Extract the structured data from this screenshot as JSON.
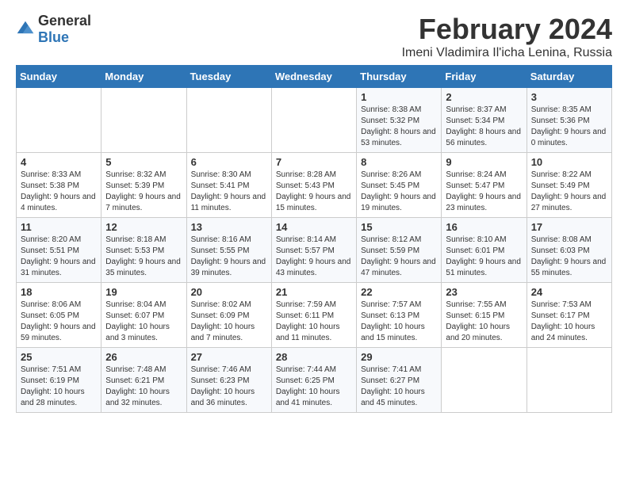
{
  "header": {
    "logo_general": "General",
    "logo_blue": "Blue",
    "title": "February 2024",
    "subtitle": "Imeni Vladimira Il'icha Lenina, Russia"
  },
  "weekdays": [
    "Sunday",
    "Monday",
    "Tuesday",
    "Wednesday",
    "Thursday",
    "Friday",
    "Saturday"
  ],
  "weeks": [
    [
      {
        "day": "",
        "info": ""
      },
      {
        "day": "",
        "info": ""
      },
      {
        "day": "",
        "info": ""
      },
      {
        "day": "",
        "info": ""
      },
      {
        "day": "1",
        "info": "Sunrise: 8:38 AM\nSunset: 5:32 PM\nDaylight: 8 hours and 53 minutes."
      },
      {
        "day": "2",
        "info": "Sunrise: 8:37 AM\nSunset: 5:34 PM\nDaylight: 8 hours and 56 minutes."
      },
      {
        "day": "3",
        "info": "Sunrise: 8:35 AM\nSunset: 5:36 PM\nDaylight: 9 hours and 0 minutes."
      }
    ],
    [
      {
        "day": "4",
        "info": "Sunrise: 8:33 AM\nSunset: 5:38 PM\nDaylight: 9 hours and 4 minutes."
      },
      {
        "day": "5",
        "info": "Sunrise: 8:32 AM\nSunset: 5:39 PM\nDaylight: 9 hours and 7 minutes."
      },
      {
        "day": "6",
        "info": "Sunrise: 8:30 AM\nSunset: 5:41 PM\nDaylight: 9 hours and 11 minutes."
      },
      {
        "day": "7",
        "info": "Sunrise: 8:28 AM\nSunset: 5:43 PM\nDaylight: 9 hours and 15 minutes."
      },
      {
        "day": "8",
        "info": "Sunrise: 8:26 AM\nSunset: 5:45 PM\nDaylight: 9 hours and 19 minutes."
      },
      {
        "day": "9",
        "info": "Sunrise: 8:24 AM\nSunset: 5:47 PM\nDaylight: 9 hours and 23 minutes."
      },
      {
        "day": "10",
        "info": "Sunrise: 8:22 AM\nSunset: 5:49 PM\nDaylight: 9 hours and 27 minutes."
      }
    ],
    [
      {
        "day": "11",
        "info": "Sunrise: 8:20 AM\nSunset: 5:51 PM\nDaylight: 9 hours and 31 minutes."
      },
      {
        "day": "12",
        "info": "Sunrise: 8:18 AM\nSunset: 5:53 PM\nDaylight: 9 hours and 35 minutes."
      },
      {
        "day": "13",
        "info": "Sunrise: 8:16 AM\nSunset: 5:55 PM\nDaylight: 9 hours and 39 minutes."
      },
      {
        "day": "14",
        "info": "Sunrise: 8:14 AM\nSunset: 5:57 PM\nDaylight: 9 hours and 43 minutes."
      },
      {
        "day": "15",
        "info": "Sunrise: 8:12 AM\nSunset: 5:59 PM\nDaylight: 9 hours and 47 minutes."
      },
      {
        "day": "16",
        "info": "Sunrise: 8:10 AM\nSunset: 6:01 PM\nDaylight: 9 hours and 51 minutes."
      },
      {
        "day": "17",
        "info": "Sunrise: 8:08 AM\nSunset: 6:03 PM\nDaylight: 9 hours and 55 minutes."
      }
    ],
    [
      {
        "day": "18",
        "info": "Sunrise: 8:06 AM\nSunset: 6:05 PM\nDaylight: 9 hours and 59 minutes."
      },
      {
        "day": "19",
        "info": "Sunrise: 8:04 AM\nSunset: 6:07 PM\nDaylight: 10 hours and 3 minutes."
      },
      {
        "day": "20",
        "info": "Sunrise: 8:02 AM\nSunset: 6:09 PM\nDaylight: 10 hours and 7 minutes."
      },
      {
        "day": "21",
        "info": "Sunrise: 7:59 AM\nSunset: 6:11 PM\nDaylight: 10 hours and 11 minutes."
      },
      {
        "day": "22",
        "info": "Sunrise: 7:57 AM\nSunset: 6:13 PM\nDaylight: 10 hours and 15 minutes."
      },
      {
        "day": "23",
        "info": "Sunrise: 7:55 AM\nSunset: 6:15 PM\nDaylight: 10 hours and 20 minutes."
      },
      {
        "day": "24",
        "info": "Sunrise: 7:53 AM\nSunset: 6:17 PM\nDaylight: 10 hours and 24 minutes."
      }
    ],
    [
      {
        "day": "25",
        "info": "Sunrise: 7:51 AM\nSunset: 6:19 PM\nDaylight: 10 hours and 28 minutes."
      },
      {
        "day": "26",
        "info": "Sunrise: 7:48 AM\nSunset: 6:21 PM\nDaylight: 10 hours and 32 minutes."
      },
      {
        "day": "27",
        "info": "Sunrise: 7:46 AM\nSunset: 6:23 PM\nDaylight: 10 hours and 36 minutes."
      },
      {
        "day": "28",
        "info": "Sunrise: 7:44 AM\nSunset: 6:25 PM\nDaylight: 10 hours and 41 minutes."
      },
      {
        "day": "29",
        "info": "Sunrise: 7:41 AM\nSunset: 6:27 PM\nDaylight: 10 hours and 45 minutes."
      },
      {
        "day": "",
        "info": ""
      },
      {
        "day": "",
        "info": ""
      }
    ]
  ]
}
